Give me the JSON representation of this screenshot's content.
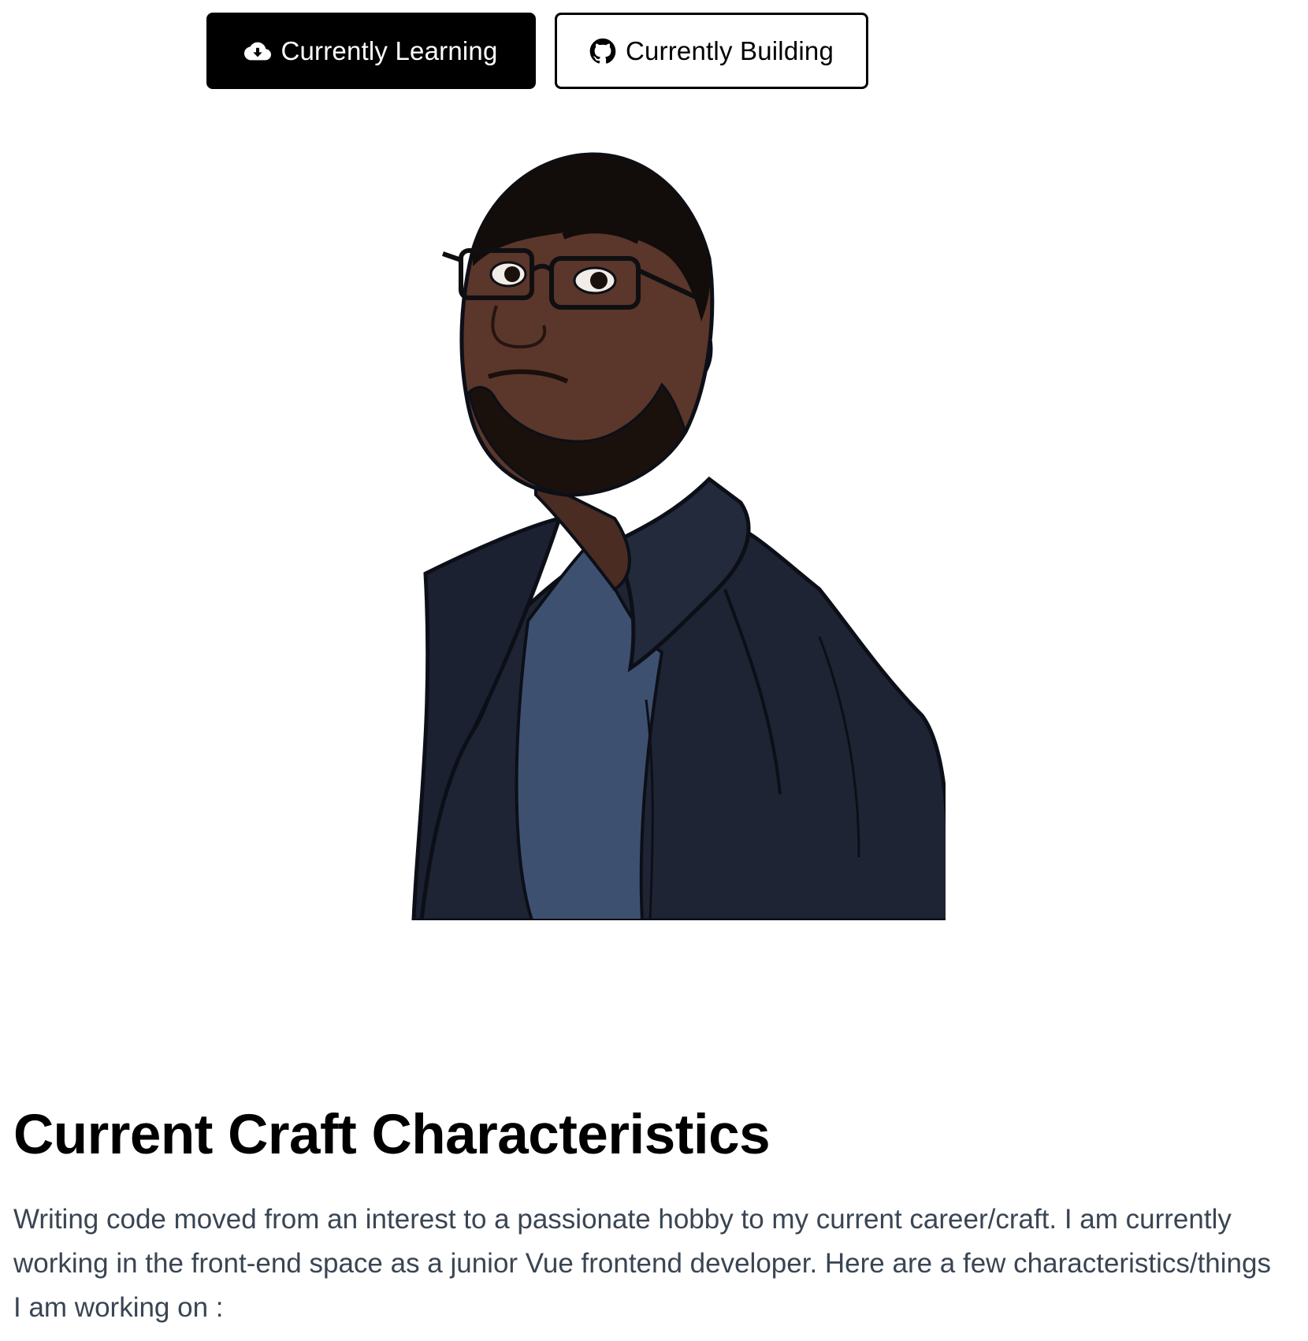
{
  "buttons": {
    "learning": {
      "label": "Currently Learning",
      "icon": "cloud-download-icon"
    },
    "building": {
      "label": "Currently Building",
      "icon": "github-icon"
    }
  },
  "colors": {
    "primary_button_bg": "#000000",
    "primary_button_text": "#ffffff",
    "outline_button_border": "#000000",
    "heading": "#000000",
    "body_text": "#3a4553"
  },
  "section": {
    "title": "Current Craft Characteristics",
    "description": "Writing code moved from an interest to a passionate hobby to my current career/craft. I am currently working in the front-end space as a junior Vue frontend developer. Here are a few characteristics/things I am working on :"
  }
}
